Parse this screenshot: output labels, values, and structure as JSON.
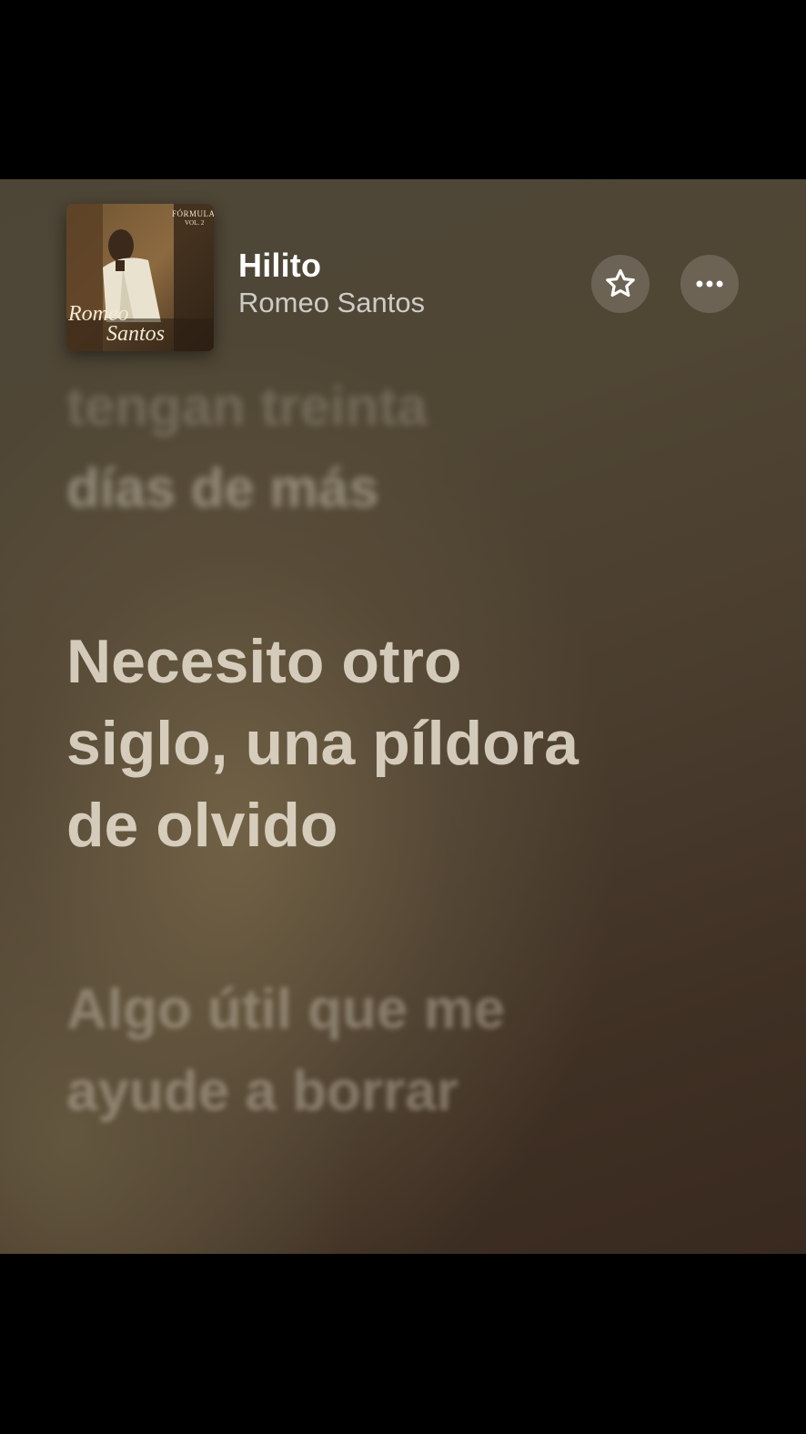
{
  "now_playing": {
    "title": "Hilito",
    "artist": "Romeo Santos",
    "artwork": {
      "icon": "album-artwork-icon",
      "text_line1": "FÓRMULA",
      "text_line2": "VOL. 2",
      "text_name1": "Romeo",
      "text_name2": "Santos"
    }
  },
  "buttons": {
    "favorite_icon": "star-icon",
    "more_icon": "ellipsis-icon"
  },
  "lyrics": {
    "previous": [
      "tengan treinta",
      "días de más"
    ],
    "current": [
      "Necesito otro",
      "siglo, una píldora",
      "de olvido"
    ],
    "next": [
      "Algo útil que me",
      "ayude a borrar"
    ]
  },
  "colors": {
    "background_warm": "#504634",
    "background_dark": "#392a20",
    "text_primary": "#ffffff"
  }
}
